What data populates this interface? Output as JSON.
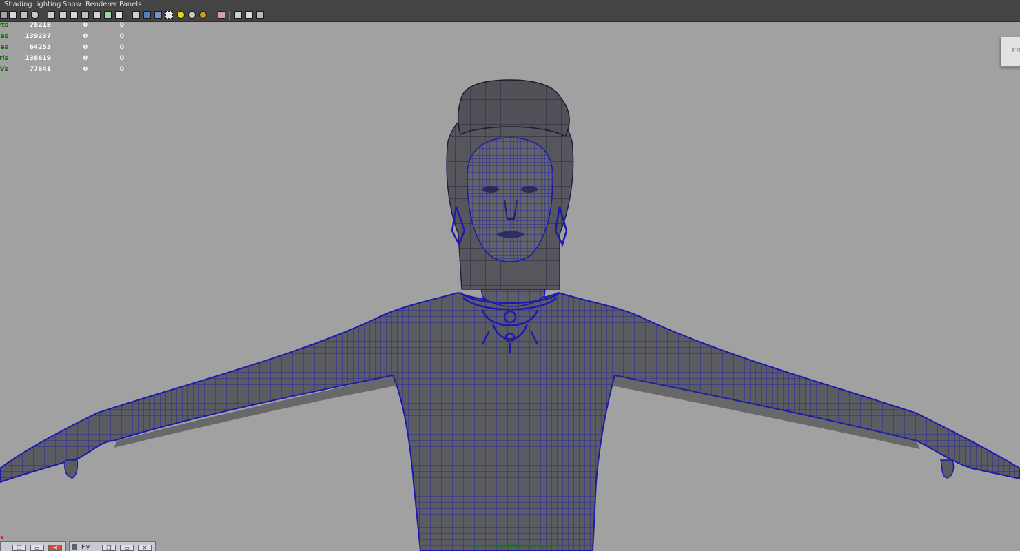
{
  "menubar": {
    "items": [
      "Shading",
      "Lighting",
      "Show",
      "Renderer",
      "Panels"
    ]
  },
  "toolbar": {
    "icons": [
      "camera-icon",
      "bookmark-icon",
      "image-plane-icon",
      "light-icon",
      "grid-icon",
      "film-gate-icon",
      "resolution-gate-icon",
      "field-chart-icon",
      "safe-action-icon",
      "safe-title-icon",
      "wireframe-icon",
      "smooth-shade-icon",
      "shade-wireframe-icon",
      "texture-icon",
      "default-light-icon",
      "all-lights-icon",
      "shadow-icon",
      "isolate-select-icon",
      "xray-icon",
      "xray-joints-icon",
      "backface-icon"
    ]
  },
  "hud": {
    "rows": [
      {
        "label": "Verts:",
        "values": [
          "75218",
          "0",
          "0"
        ]
      },
      {
        "label": "Edges:",
        "values": [
          "139237",
          "0",
          "0"
        ]
      },
      {
        "label": "Faces:",
        "values": [
          "64253",
          "0",
          "0"
        ]
      },
      {
        "label": "Tris:",
        "values": [
          "138619",
          "0",
          "0"
        ]
      },
      {
        "label": "UVs:",
        "values": [
          "77841",
          "0",
          "0"
        ]
      }
    ]
  },
  "viewcube": {
    "label": "FRO"
  },
  "taskbar": {
    "left_close_glyph": "x",
    "window2_label": "Hy",
    "restore_glyph": "❐",
    "maximize_glyph": "▭",
    "close_glyph": "✕"
  },
  "status": {
    "layer_label": "Front (defaultRenderLayer)"
  },
  "colors": {
    "viewport_bg": "#a1a1a1",
    "mesh_fill": "#5b5b62",
    "wire": "#1a1ab0",
    "hud_label": "#0b6b0b",
    "hud_value": "#ffffff",
    "chrome": "#444444"
  }
}
